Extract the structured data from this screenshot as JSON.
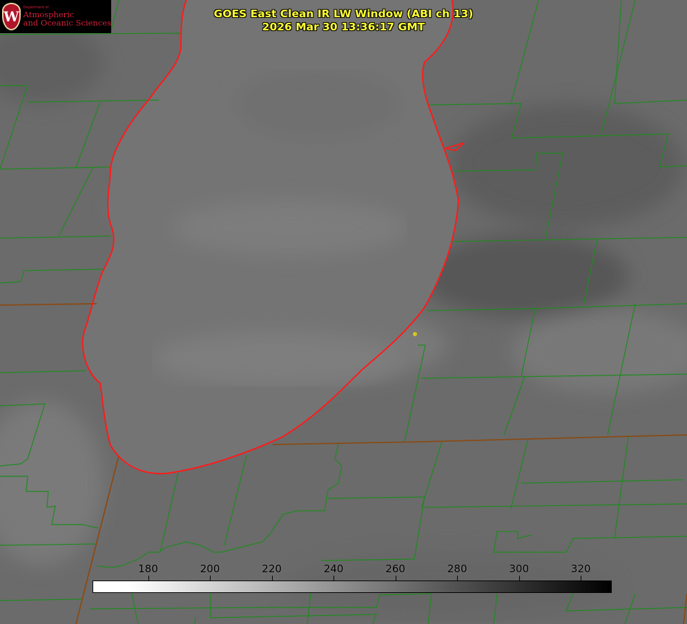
{
  "logo": {
    "department": "Department of",
    "line1": "Atmospheric",
    "line2": "and Oceanic Sciences",
    "seal_letter": "W"
  },
  "title": {
    "line1": "GOES East Clean IR LW Window (ABI ch 13)",
    "line2": "2026 Mar 30 13:36:17 GMT"
  },
  "colorbar": {
    "ticks": [
      "180",
      "200",
      "220",
      "240",
      "260",
      "280",
      "300",
      "320"
    ],
    "min": 162,
    "max": 330,
    "gradient": "white-to-black"
  },
  "map": {
    "background_gray": "#6a6a6a",
    "lake_gray": "#737373",
    "county_line_color": "#1f8a1f",
    "state_line_color": "#8a4a14",
    "shoreline_color": "#ff1a1a",
    "marker_color": "#d8c81a"
  }
}
